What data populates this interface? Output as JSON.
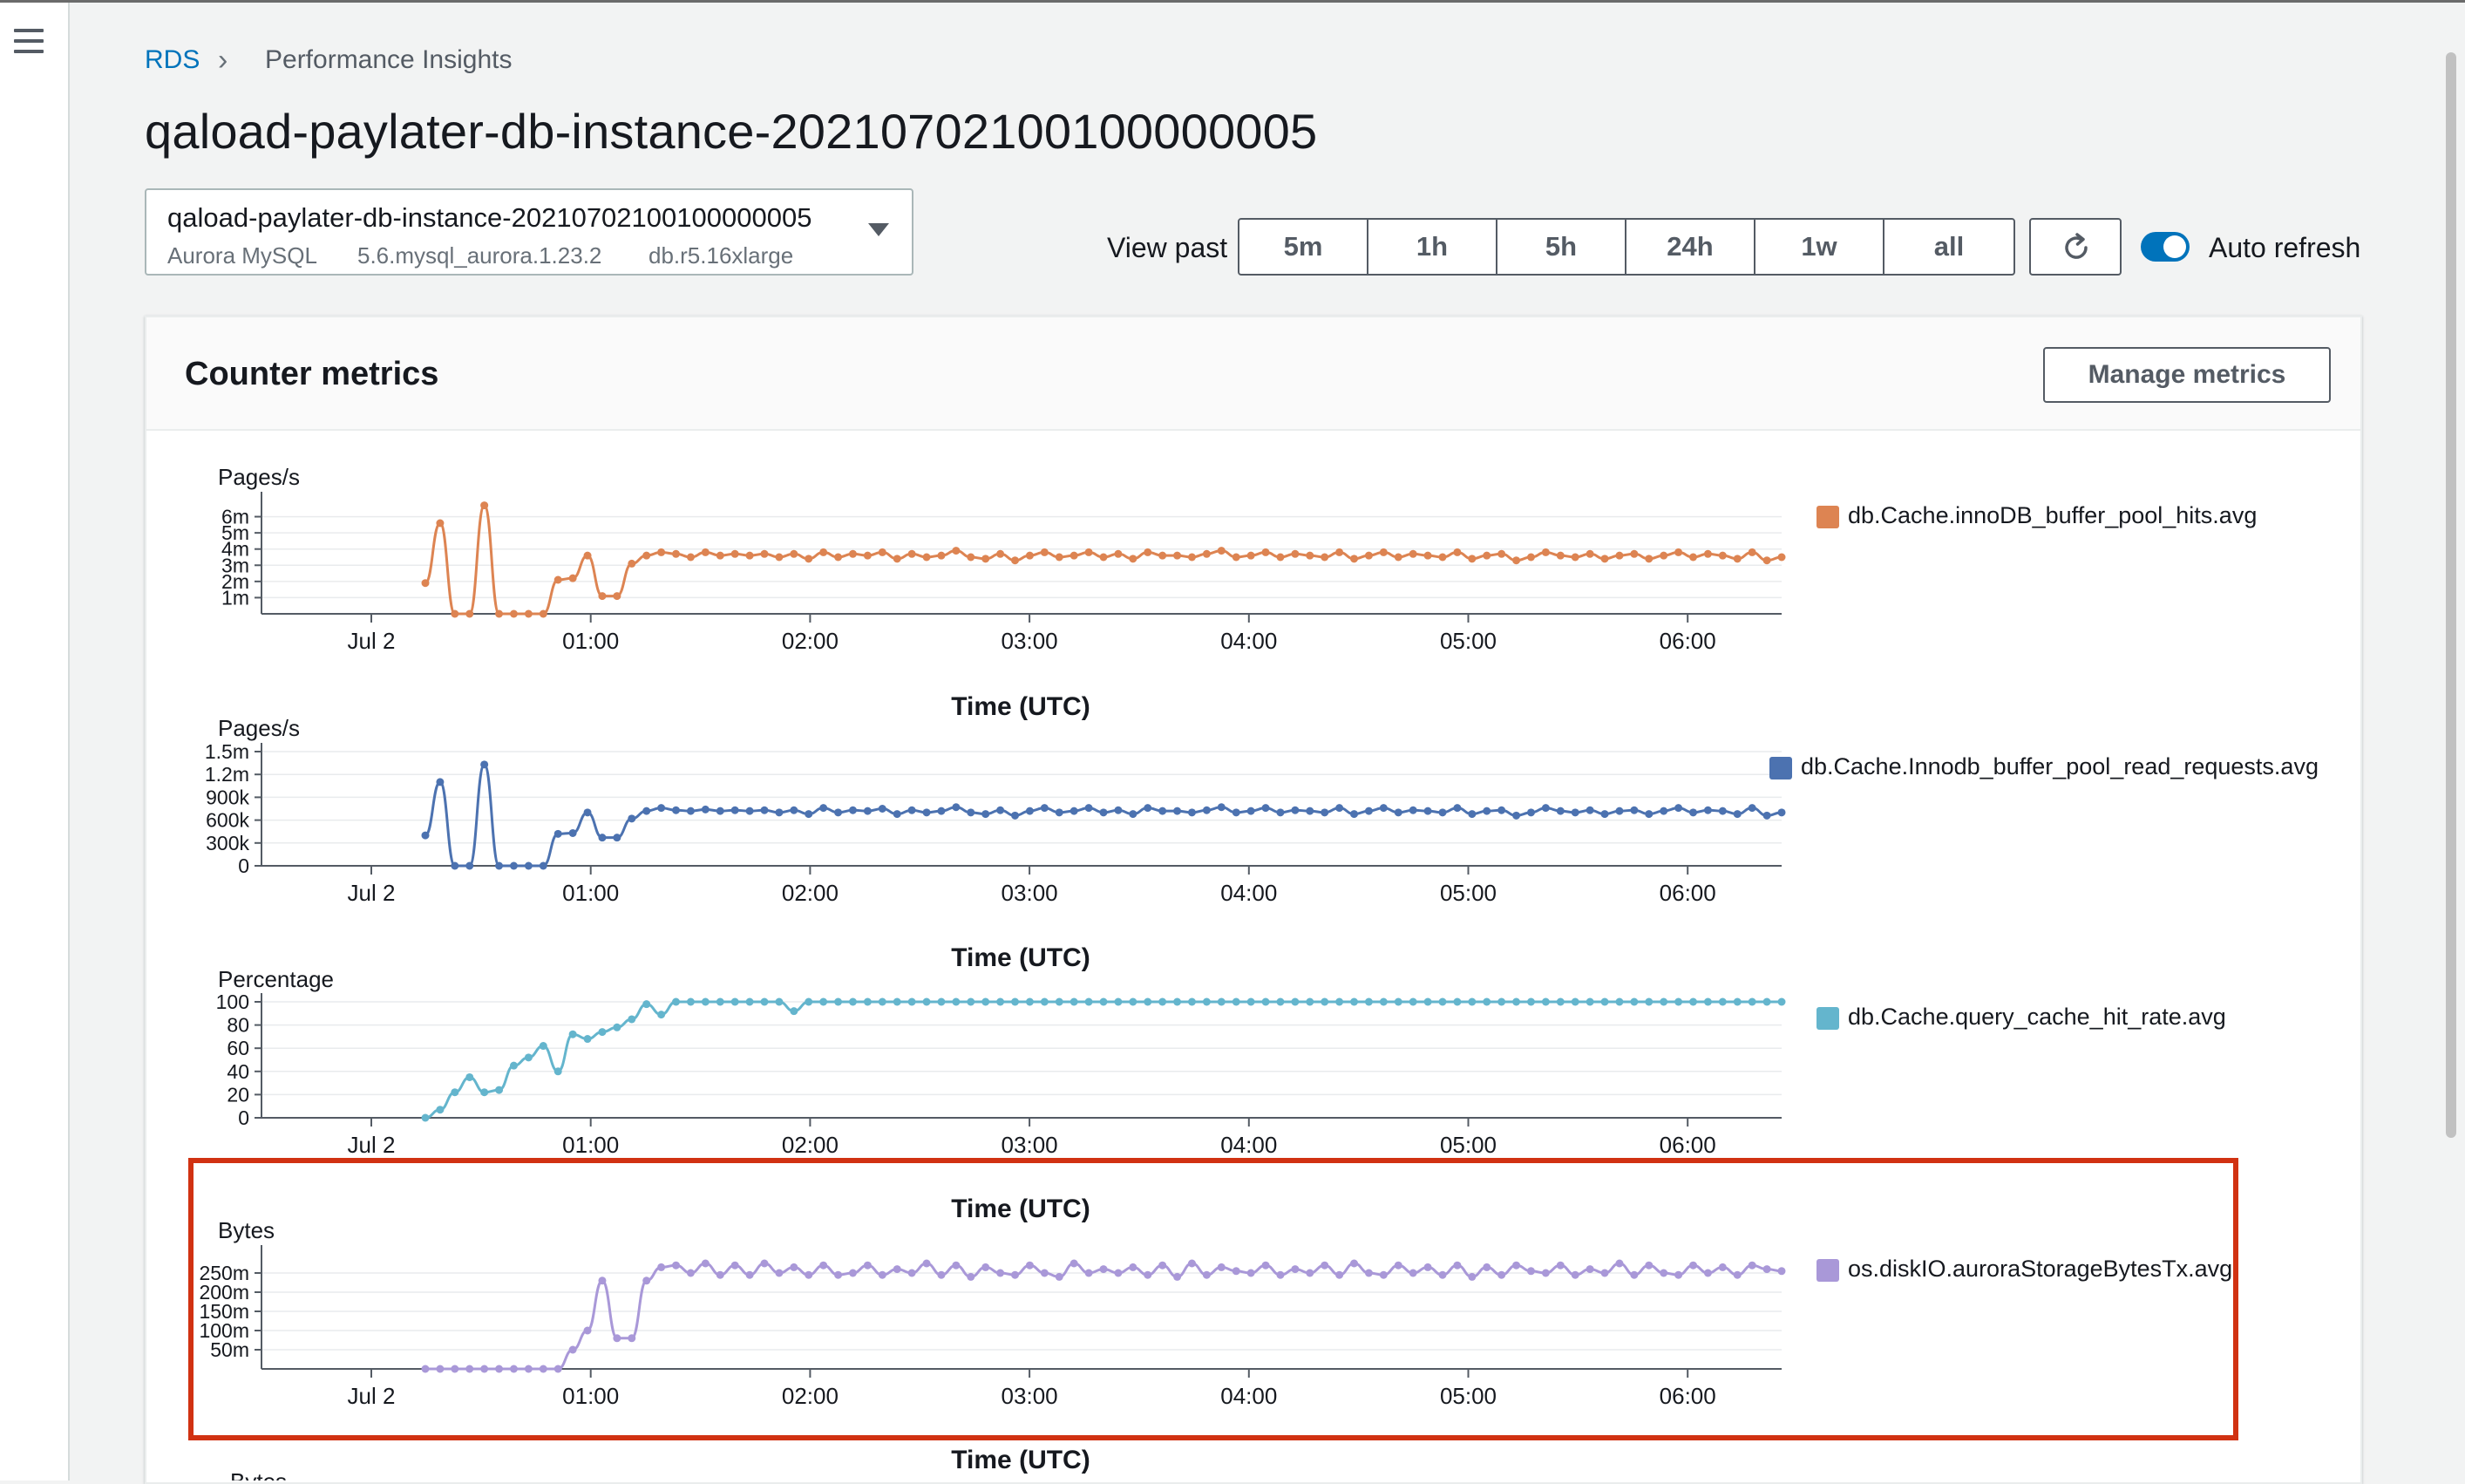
{
  "nav": {
    "menu_icon": "hamburger-menu-icon"
  },
  "breadcrumb": {
    "root": "RDS",
    "separator": "chevron-right-icon",
    "current": "Performance Insights"
  },
  "page_title": "qaload-paylater-db-instance-20210702100100000005",
  "instance_selector": {
    "name": "qaload-paylater-db-instance-20210702100100000005",
    "engine": "Aurora MySQL",
    "version": "5.6.mysql_aurora.1.23.2",
    "class": "db.r5.16xlarge"
  },
  "view_past": {
    "label": "View past",
    "options": [
      "5m",
      "1h",
      "5h",
      "24h",
      "1w",
      "all"
    ]
  },
  "refresh": {
    "icon": "refresh-icon"
  },
  "auto_refresh": {
    "label": "Auto refresh",
    "enabled": true
  },
  "panel": {
    "title": "Counter metrics",
    "manage_button": "Manage metrics"
  },
  "colors": {
    "accent": "#0073bb",
    "highlight": "#d13212"
  },
  "chart_data": [
    {
      "type": "line",
      "ylabel": "Pages/s",
      "xlabel": "Time (UTC)",
      "x_ticks": [
        "Jul 2",
        "01:00",
        "02:00",
        "03:00",
        "04:00",
        "05:00",
        "06:00"
      ],
      "y_ticks": [
        "1m",
        "2m",
        "3m",
        "4m",
        "5m",
        "6m"
      ],
      "ylim": [
        0,
        7
      ],
      "grid": true,
      "series": [
        {
          "name": "db.Cache.innoDB_buffer_pool_hits.avg",
          "color": "#dd8452",
          "values": [
            1.9,
            5.6,
            0,
            0,
            6.7,
            0,
            0,
            0,
            0,
            2.1,
            2.2,
            3.6,
            1.1,
            1.1,
            3.1,
            3.6,
            3.8,
            3.7,
            3.5,
            3.8,
            3.6,
            3.7,
            3.6,
            3.7,
            3.5,
            3.7,
            3.4,
            3.8,
            3.5,
            3.7,
            3.6,
            3.8,
            3.4,
            3.7,
            3.5,
            3.6,
            3.9,
            3.5,
            3.4,
            3.7,
            3.3,
            3.6,
            3.8,
            3.5,
            3.6,
            3.8,
            3.5,
            3.7,
            3.4,
            3.8,
            3.6,
            3.6,
            3.5,
            3.7,
            3.9,
            3.5,
            3.6,
            3.8,
            3.5,
            3.7,
            3.6,
            3.5,
            3.8,
            3.4,
            3.6,
            3.8,
            3.5,
            3.7,
            3.6,
            3.5,
            3.8,
            3.4,
            3.6,
            3.7,
            3.3,
            3.5,
            3.8,
            3.6,
            3.5,
            3.7,
            3.4,
            3.6,
            3.7,
            3.4,
            3.6,
            3.8,
            3.5,
            3.7,
            3.6,
            3.4,
            3.8,
            3.3,
            3.5
          ]
        }
      ]
    },
    {
      "type": "line",
      "ylabel": "Pages/s",
      "xlabel": "Time (UTC)",
      "x_ticks": [
        "Jul 2",
        "01:00",
        "02:00",
        "03:00",
        "04:00",
        "05:00",
        "06:00"
      ],
      "y_ticks": [
        "0",
        "300k",
        "600k",
        "900k",
        "1.2m",
        "1.5m"
      ],
      "ylim": [
        0,
        1500000
      ],
      "grid": true,
      "series": [
        {
          "name": "db.Cache.Innodb_buffer_pool_read_requests.avg",
          "color": "#4c72b0",
          "values": [
            400000,
            1100000,
            0,
            0,
            1330000,
            0,
            0,
            0,
            0,
            420000,
            430000,
            700000,
            370000,
            370000,
            620000,
            720000,
            760000,
            730000,
            720000,
            740000,
            720000,
            730000,
            720000,
            730000,
            700000,
            730000,
            680000,
            760000,
            700000,
            730000,
            720000,
            750000,
            680000,
            730000,
            700000,
            720000,
            770000,
            700000,
            680000,
            730000,
            660000,
            720000,
            760000,
            700000,
            720000,
            760000,
            700000,
            730000,
            680000,
            760000,
            720000,
            720000,
            700000,
            730000,
            770000,
            700000,
            720000,
            760000,
            700000,
            730000,
            720000,
            700000,
            760000,
            680000,
            720000,
            760000,
            700000,
            730000,
            720000,
            700000,
            760000,
            680000,
            720000,
            730000,
            660000,
            700000,
            760000,
            720000,
            700000,
            730000,
            680000,
            720000,
            730000,
            680000,
            720000,
            760000,
            700000,
            730000,
            720000,
            680000,
            760000,
            660000,
            700000
          ]
        }
      ]
    },
    {
      "type": "line",
      "ylabel": "Percentage",
      "xlabel": "Time (UTC)",
      "x_ticks": [
        "Jul 2",
        "01:00",
        "02:00",
        "03:00",
        "04:00",
        "05:00",
        "06:00"
      ],
      "y_ticks": [
        "0",
        "20",
        "40",
        "60",
        "80",
        "100"
      ],
      "ylim": [
        0,
        100
      ],
      "grid": true,
      "series": [
        {
          "name": "db.Cache.query_cache_hit_rate.avg",
          "color": "#64b5cd",
          "values": [
            0,
            7,
            22,
            35,
            22,
            24,
            45,
            52,
            62,
            40,
            72,
            68,
            74,
            78,
            85,
            98,
            89,
            100,
            100,
            100,
            100,
            100,
            100,
            100,
            100,
            92,
            100,
            100,
            100,
            100,
            100,
            100,
            100,
            100,
            100,
            100,
            100,
            100,
            100,
            100,
            100,
            100,
            100,
            100,
            100,
            100,
            100,
            100,
            100,
            100,
            100,
            100,
            100,
            100,
            100,
            100,
            100,
            100,
            100,
            100,
            100,
            100,
            100,
            100,
            100,
            100,
            100,
            100,
            100,
            100,
            100,
            100,
            100,
            100,
            100,
            100,
            100,
            100,
            100,
            100,
            100,
            100,
            100,
            100,
            100,
            100,
            100,
            100,
            100,
            100,
            100,
            100,
            100
          ]
        }
      ]
    },
    {
      "type": "line",
      "ylabel": "Bytes",
      "xlabel": "Time (UTC)",
      "x_ticks": [
        "Jul 2",
        "01:00",
        "02:00",
        "03:00",
        "04:00",
        "05:00",
        "06:00"
      ],
      "y_ticks": [
        "50m",
        "100m",
        "150m",
        "200m",
        "250m"
      ],
      "ylim": [
        0,
        300
      ],
      "grid": true,
      "series": [
        {
          "name": "os.diskIO.auroraStorageBytesTx.avg",
          "color": "#a998d8",
          "values": [
            0,
            0,
            0,
            0,
            0,
            0,
            0,
            0,
            0,
            0,
            50,
            100,
            230,
            80,
            80,
            230,
            265,
            270,
            250,
            275,
            245,
            270,
            245,
            275,
            250,
            265,
            245,
            270,
            245,
            250,
            270,
            245,
            260,
            250,
            275,
            245,
            270,
            240,
            265,
            250,
            245,
            270,
            250,
            240,
            275,
            250,
            260,
            250,
            265,
            245,
            270,
            240,
            275,
            245,
            265,
            255,
            250,
            270,
            245,
            260,
            250,
            270,
            245,
            275,
            250,
            245,
            270,
            250,
            265,
            245,
            270,
            240,
            265,
            245,
            270,
            255,
            250,
            270,
            245,
            260,
            250,
            275,
            245,
            270,
            250,
            245,
            270,
            250,
            265,
            245,
            270,
            260,
            255
          ]
        }
      ]
    }
  ],
  "next_chart": {
    "ylabel": "Bytes"
  }
}
